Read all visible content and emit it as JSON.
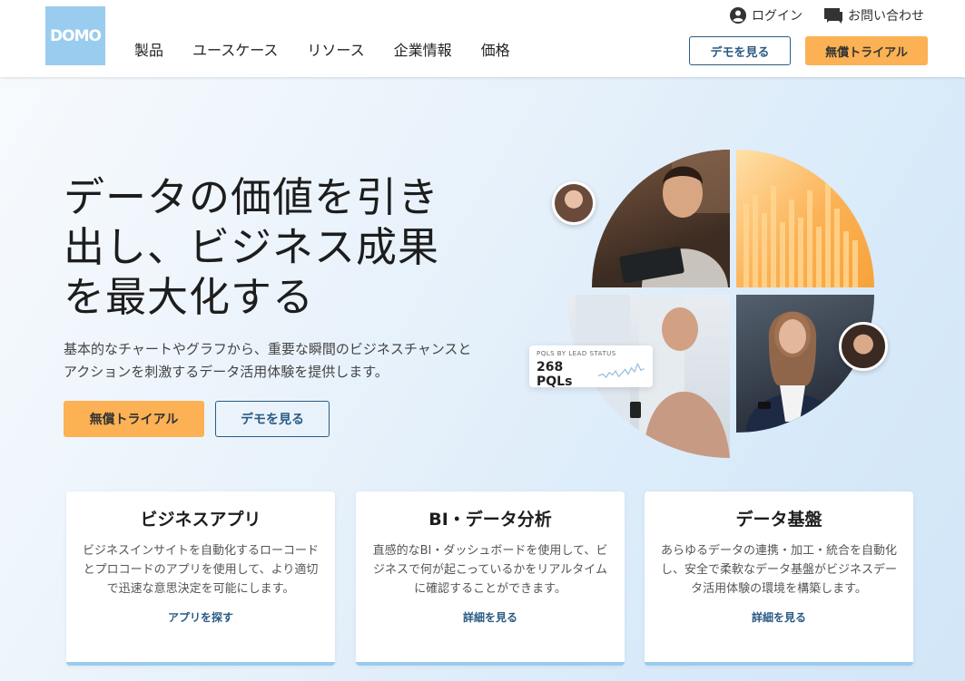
{
  "header": {
    "logo_text": "DOMO",
    "nav": [
      "製品",
      "ユースケース",
      "リソース",
      "企業情報",
      "価格"
    ],
    "login_label": "ログイン",
    "contact_label": "お問い合わせ",
    "demo_label": "デモを見る",
    "trial_label": "無償トライアル"
  },
  "hero": {
    "title": "データの価値を引き出し、ビジネス成果を最大化する",
    "subtitle": "基本的なチャートやグラフから、重要な瞬間のビジネスチャンスとアクションを刺激するデータ活用体験を提供します。",
    "trial_label": "無償トライアル",
    "demo_label": "デモを見る",
    "metric_label": "PQLS BY LEAD STATUS",
    "metric_value": "268 PQLs"
  },
  "cards": [
    {
      "title": "ビジネスアプリ",
      "desc": "ビジネスインサイトを自動化するローコードとプロコードのアプリを使用して、より適切で迅速な意思決定を可能にします。",
      "link": "アプリを探す"
    },
    {
      "title": "BI・データ分析",
      "desc": "直感的なBI・ダッシュボードを使用して、ビジネスで何が起こっているかをリアルタイムに確認することができます。",
      "link": "詳細を見る"
    },
    {
      "title": "データ基盤",
      "desc": "あらゆるデータの連携・加工・統合を自動化し、安全で柔軟なデータ基盤がビジネスデータ活用体験の環境を構築します。",
      "link": "詳細を見る"
    }
  ],
  "colors": {
    "accent_orange": "#fbb154",
    "brand_blue": "#99ccee",
    "button_border": "#2a5b84"
  }
}
